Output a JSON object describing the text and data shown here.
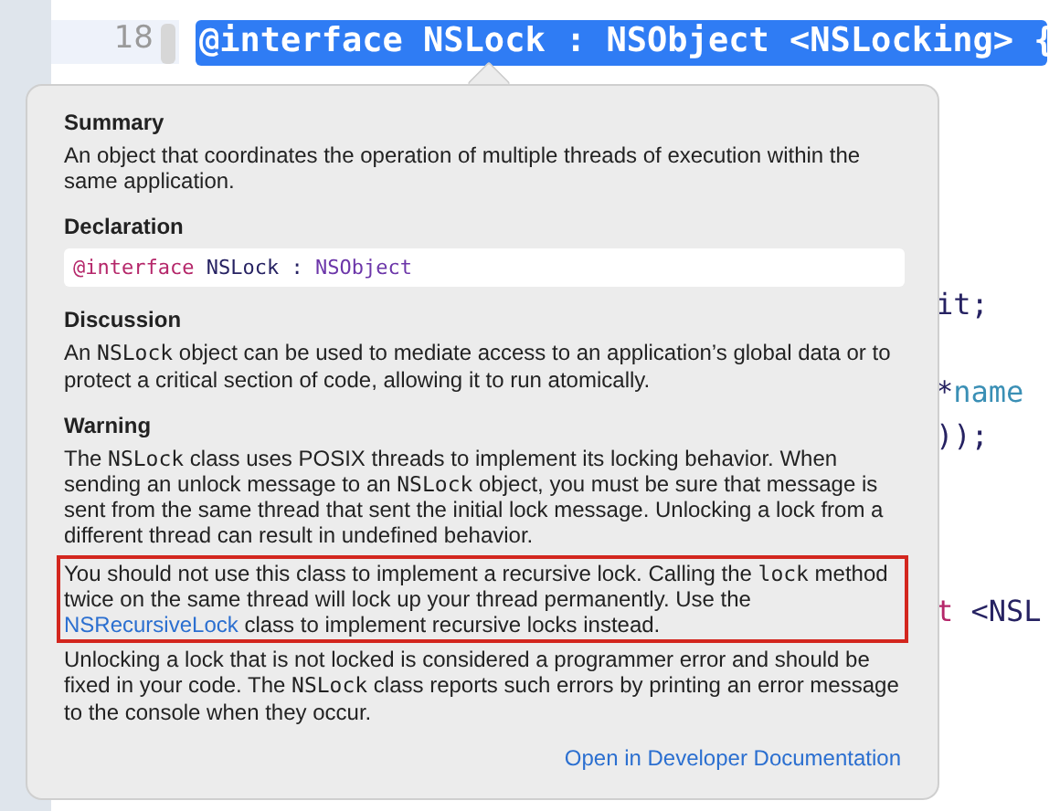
{
  "editor": {
    "lines": [
      {
        "number": "18",
        "selected": true,
        "text": "@interface NSLock : NSObject <NSLocking> {"
      }
    ],
    "hidden_line_ends": [
      {
        "tokens": [
          {
            "text": "it;",
            "kind": "plain"
          }
        ]
      },
      {
        "tokens": [
          {
            "text": "*",
            "kind": "plain"
          },
          {
            "text": "name",
            "kind": "identifier"
          }
        ]
      },
      {
        "tokens": [
          {
            "text": "));",
            "kind": "plain"
          }
        ]
      },
      {
        "tokens": [
          {
            "text": "t",
            "kind": "keyword"
          },
          {
            "text": " <NSL",
            "kind": "plain"
          }
        ]
      }
    ]
  },
  "popover": {
    "sections": [
      {
        "heading": "Summary",
        "kind": "text",
        "paragraphs": [
          {
            "highlighted": false,
            "runs": [
              {
                "kind": "text",
                "text": "An object that coordinates the operation of multiple threads of execution within the same application."
              }
            ]
          }
        ]
      },
      {
        "heading": "Declaration",
        "kind": "code",
        "tokens": [
          {
            "text": "@interface",
            "kind": "keyword"
          },
          {
            "text": " NSLock : ",
            "kind": "plain"
          },
          {
            "text": "NSObject",
            "kind": "type"
          }
        ]
      },
      {
        "heading": "Discussion",
        "kind": "text",
        "paragraphs": [
          {
            "highlighted": false,
            "runs": [
              {
                "kind": "text",
                "text": "An "
              },
              {
                "kind": "code",
                "text": "NSLock"
              },
              {
                "kind": "text",
                "text": " object can be used to mediate access to an application’s global data or to protect a critical section of code, allowing it to run atomically."
              }
            ]
          }
        ]
      },
      {
        "heading": "Warning",
        "kind": "text",
        "paragraphs": [
          {
            "highlighted": false,
            "runs": [
              {
                "kind": "text",
                "text": "The "
              },
              {
                "kind": "code",
                "text": "NSLock"
              },
              {
                "kind": "text",
                "text": " class uses POSIX threads to implement its locking behavior. When sending an unlock message to an "
              },
              {
                "kind": "code",
                "text": "NSLock"
              },
              {
                "kind": "text",
                "text": " object, you must be sure that message is sent from the same thread that sent the initial lock message. Unlocking a lock from a different thread can result in undefined behavior."
              }
            ]
          },
          {
            "highlighted": true,
            "runs": [
              {
                "kind": "text",
                "text": "You should not use this class to implement a recursive lock. Calling the "
              },
              {
                "kind": "code",
                "text": "lock"
              },
              {
                "kind": "text",
                "text": " method twice on the same thread will lock up your thread permanently. Use the "
              },
              {
                "kind": "link",
                "text": "NSRecursiveLock"
              },
              {
                "kind": "text",
                "text": " class to implement recursive locks instead."
              }
            ]
          },
          {
            "highlighted": false,
            "runs": [
              {
                "kind": "text",
                "text": "Unlocking a lock that is not locked is considered a programmer error and should be fixed in your code. The "
              },
              {
                "kind": "code",
                "text": "NSLock"
              },
              {
                "kind": "text",
                "text": " class reports such errors by printing an error message to the console when they occur."
              }
            ]
          }
        ]
      }
    ],
    "footer_link": "Open in Developer Documentation"
  }
}
